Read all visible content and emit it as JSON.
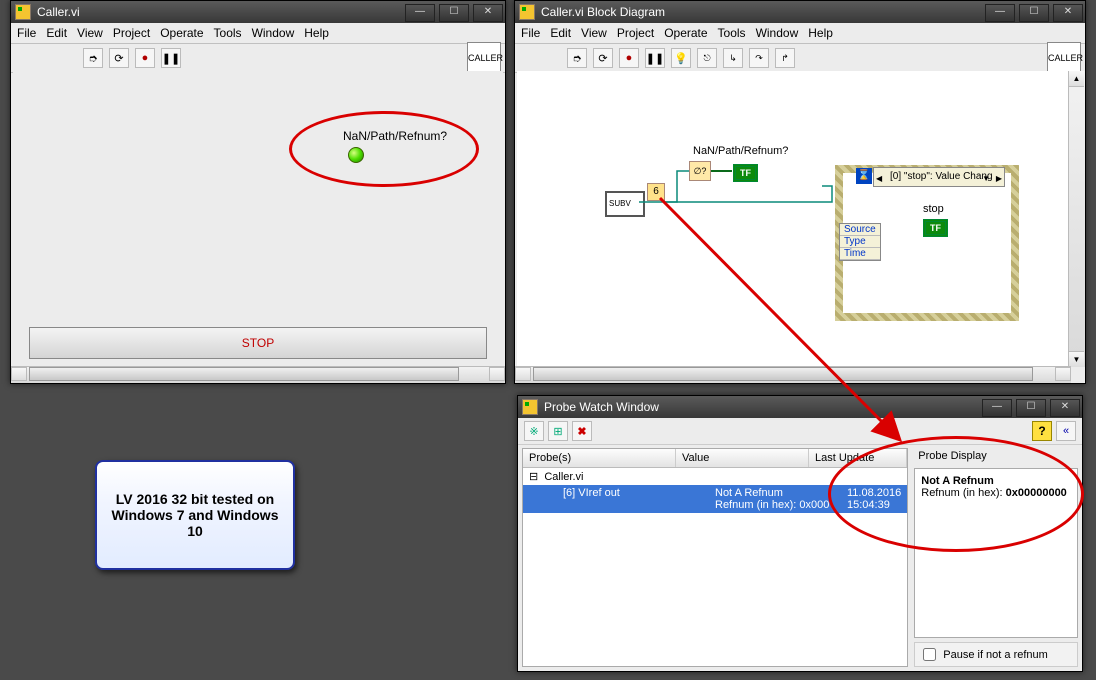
{
  "win1": {
    "title": "Caller.vi",
    "menu": [
      "File",
      "Edit",
      "View",
      "Project",
      "Operate",
      "Tools",
      "Window",
      "Help"
    ],
    "badge": "CALLER",
    "label_nan": "NaN/Path/Refnum?",
    "stop": "STOP"
  },
  "win2": {
    "title": "Caller.vi Block Diagram",
    "menu": [
      "File",
      "Edit",
      "View",
      "Project",
      "Operate",
      "Tools",
      "Window",
      "Help"
    ],
    "badge": "CALLER",
    "label_nan": "NaN/Path/Refnum?",
    "subvi": "SUBV",
    "probe_num": "6",
    "tf": "TF",
    "event_case": "[0] \"stop\": Value Chang",
    "stop_label": "stop",
    "datanode": [
      "Source",
      "Type",
      "Time"
    ]
  },
  "probe": {
    "title": "Probe Watch Window",
    "columns": [
      "Probe(s)",
      "Value",
      "Last Update"
    ],
    "row_parent": "Caller.vi",
    "row_child_name": "[6] VIref out",
    "row_child_value": "Not A Refnum\nRefnum (in hex): 0x000",
    "row_child_time": "11.08.2016 15:04:39",
    "display_label": "Probe Display",
    "display_title": "Not A Refnum",
    "display_line": "Refnum (in hex):",
    "display_hex": "0x00000000",
    "pause": "Pause if not a refnum"
  },
  "note": "LV 2016 32 bit tested on Windows 7 and Windows 10",
  "icons": {
    "run": "➮",
    "runcont": "⟳",
    "stop": "●",
    "pause": "❚❚",
    "bulb": "💡",
    "help": "?",
    "x": "✖",
    "min": "—",
    "max": "☐",
    "close": "✕",
    "tree_minus": "⊟"
  }
}
